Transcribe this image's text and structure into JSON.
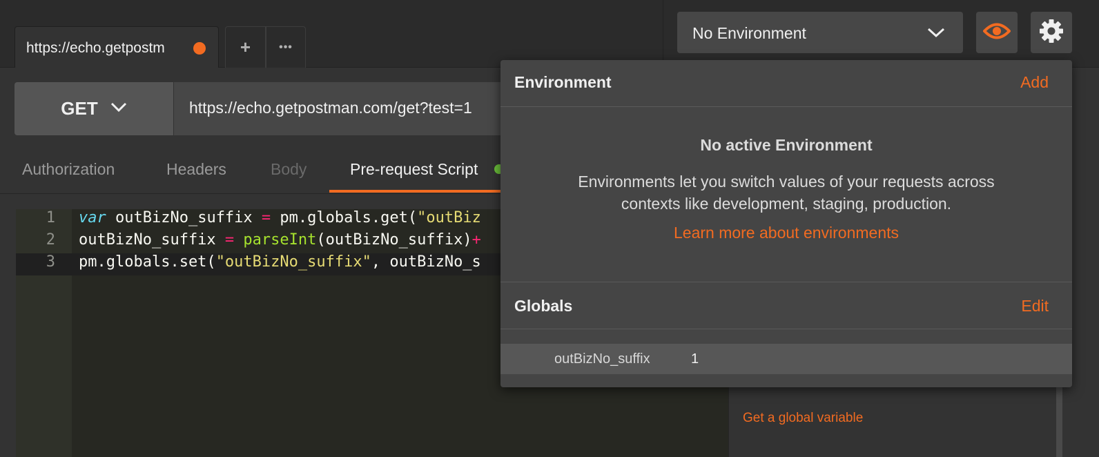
{
  "tabs": {
    "active_title": "https://echo.getpostm",
    "plus_label": "+",
    "more_label": "•••"
  },
  "environment": {
    "selected": "No Environment",
    "eye_icon": "eye-icon",
    "gear_icon": "gear-icon"
  },
  "request": {
    "method": "GET",
    "url": "https://echo.getpostman.com/get?test=1"
  },
  "subtabs": {
    "authorization": "Authorization",
    "headers": "Headers",
    "body": "Body",
    "prerequest": "Pre-request Script"
  },
  "editor": {
    "lines": [
      {
        "num": "1",
        "tokens": [
          {
            "t": "var",
            "c": "kw"
          },
          {
            "t": " outBizNo_suffix ",
            "c": ""
          },
          {
            "t": "=",
            "c": "op"
          },
          {
            "t": " pm.globals.get(",
            "c": ""
          },
          {
            "t": "\"outBiz",
            "c": "str"
          }
        ]
      },
      {
        "num": "2",
        "tokens": [
          {
            "t": "outBizNo_suffix ",
            "c": ""
          },
          {
            "t": "=",
            "c": "op"
          },
          {
            "t": " ",
            "c": ""
          },
          {
            "t": "parseInt",
            "c": "fn"
          },
          {
            "t": "(outBizNo_suffix)",
            "c": ""
          },
          {
            "t": "+",
            "c": "op"
          }
        ]
      },
      {
        "num": "3",
        "tokens": [
          {
            "t": "pm.globals.set(",
            "c": ""
          },
          {
            "t": "\"outBizNo_suffix\"",
            "c": "str"
          },
          {
            "t": ", outBizNo_s",
            "c": ""
          }
        ]
      }
    ]
  },
  "popover": {
    "environment_heading": "Environment",
    "add_label": "Add",
    "empty_title": "No active Environment",
    "empty_desc_line1": "Environments let you switch values of your requests across",
    "empty_desc_line2": "contexts like development, staging, production.",
    "learn_more": "Learn more about environments",
    "globals_heading": "Globals",
    "edit_label": "Edit",
    "globals": [
      {
        "key": "outBizNo_suffix",
        "value": "1"
      }
    ]
  },
  "snippets": {
    "link": "Get a global variable"
  },
  "colors": {
    "accent": "#f26b21",
    "status_green": "#6bbf3a"
  }
}
